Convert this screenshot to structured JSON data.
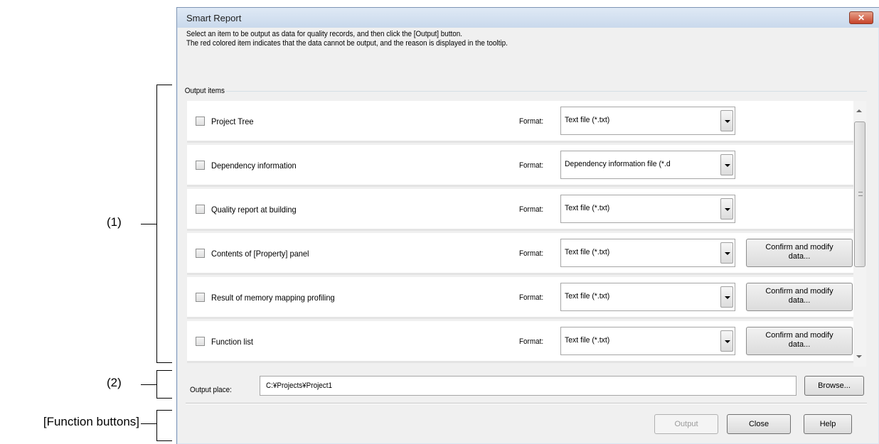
{
  "annotations": {
    "label1": "(1)",
    "label2": "(2)",
    "label3": "[Function buttons]"
  },
  "window": {
    "title": "Smart Report",
    "close_glyph": "✕",
    "description_line1": "Select an item to be output as data for quality records, and then click the [Output] button.",
    "description_line2": "The red colored item indicates that the data cannot be output, and the reason is displayed in the tooltip."
  },
  "output_items": {
    "group_label": "Output items",
    "format_label": "Format:",
    "confirm_label_line1": "Confirm and modify",
    "confirm_label_line2": "data...",
    "items": [
      {
        "label": "Project Tree",
        "format": "Text file (*.txt)",
        "checked": false,
        "has_confirm": false
      },
      {
        "label": "Dependency information",
        "format": "Dependency information file (*.d",
        "checked": false,
        "has_confirm": false
      },
      {
        "label": "Quality report at building",
        "format": "Text file (*.txt)",
        "checked": false,
        "has_confirm": false
      },
      {
        "label": "Contents of [Property] panel",
        "format": "Text file (*.txt)",
        "checked": false,
        "has_confirm": true
      },
      {
        "label": "Result of memory mapping profiling",
        "format": "Text file (*.txt)",
        "checked": false,
        "has_confirm": true
      },
      {
        "label": "Function list",
        "format": "Text file (*.txt)",
        "checked": false,
        "has_confirm": true
      }
    ]
  },
  "output_place": {
    "label": "Output place:",
    "value": "C:¥Projects¥Project1",
    "browse_label": "Browse..."
  },
  "function_buttons": {
    "output": "Output",
    "close": "Close",
    "help": "Help"
  }
}
